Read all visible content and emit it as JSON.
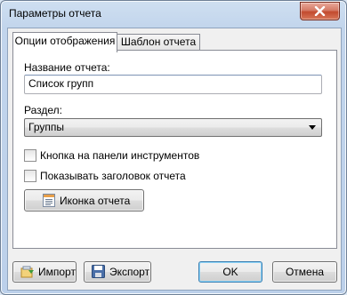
{
  "window": {
    "title": "Параметры отчета"
  },
  "tabs": [
    {
      "label": "Опции отображения",
      "active": true
    },
    {
      "label": "Шаблон отчета",
      "active": false
    }
  ],
  "form": {
    "report_name_label": "Название отчета:",
    "report_name_value": "Список групп",
    "section_label": "Раздел:",
    "section_value": "Группы",
    "toolbar_button_label": "Кнопка на панели инструментов",
    "toolbar_button_checked": false,
    "show_header_label": "Показывать заголовок отчета",
    "show_header_checked": false,
    "report_icon_button": "Иконка отчета"
  },
  "footer": {
    "import_label": "Импорт",
    "export_label": "Экспорт",
    "ok_label": "OK",
    "cancel_label": "Отмена"
  },
  "icons": {
    "close": "close-icon",
    "report": "report-icon",
    "import": "import-icon",
    "export": "floppy-disk-icon"
  },
  "colors": {
    "close_button": "#c24a2e",
    "window_frame": "#c2d5ec",
    "default_button_border": "#3c7fb1"
  }
}
